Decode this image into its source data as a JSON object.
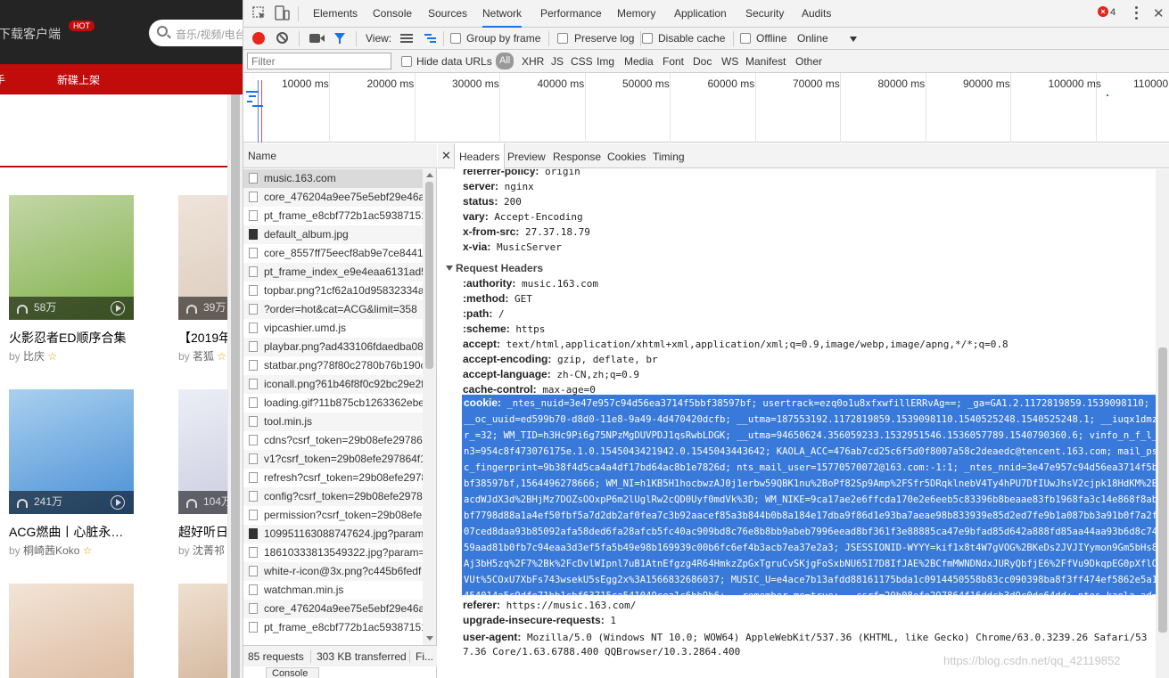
{
  "site": {
    "download_text": "下载客户端",
    "hot_badge": "HOT",
    "search_placeholder": "音乐/视频/电台",
    "subnav_first": "手",
    "subnav_new": "新碟上架",
    "playlists": [
      {
        "count": "58万",
        "title": "火影忍者ED顺序合集",
        "by": "by",
        "author": "比庆",
        "colors": [
          "#7fb24a",
          "#c4d6a8"
        ]
      },
      {
        "count": "39万",
        "title": "【2019年",
        "by": "by",
        "author": "茗狐",
        "colors": [
          "#d8c8b8",
          "#efe4da"
        ]
      },
      {
        "count": "241万",
        "title": "ACG燃曲丨心脏永…",
        "by": "by",
        "author": "桐崎茜Koko",
        "colors": [
          "#4a8fd6",
          "#a9d0ef"
        ]
      },
      {
        "count": "104万",
        "title": "超好听日",
        "by": "by",
        "author": "沈菁祁",
        "colors": [
          "#c6c8dc",
          "#eceef6"
        ]
      },
      {
        "count": "",
        "title": "",
        "by": "",
        "author": "",
        "colors": [
          "#d9b59a",
          "#f3e4d6"
        ]
      },
      {
        "count": "",
        "title": "",
        "by": "",
        "author": "",
        "colors": [
          "#c9a78a",
          "#efe0d0"
        ]
      }
    ]
  },
  "devtools": {
    "tabs": [
      "Elements",
      "Console",
      "Sources",
      "Network",
      "Performance",
      "Memory",
      "Application",
      "Security",
      "Audits"
    ],
    "active_tab": "Network",
    "error_count": "4",
    "toolbar": {
      "view_label": "View:",
      "group_by_frame": "Group by frame",
      "preserve_log": "Preserve log",
      "disable_cache": "Disable cache",
      "offline": "Offline",
      "throttle": "Online"
    },
    "filter_placeholder": "Filter",
    "hide_data_urls": "Hide data URLs",
    "types": [
      "All",
      "XHR",
      "JS",
      "CSS",
      "Img",
      "Media",
      "Font",
      "Doc",
      "WS",
      "Manifest",
      "Other"
    ],
    "timeline_ticks": [
      "10000 ms",
      "20000 ms",
      "30000 ms",
      "40000 ms",
      "50000 ms",
      "60000 ms",
      "70000 ms",
      "80000 ms",
      "90000 ms",
      "100000 ms",
      "110000 ms"
    ],
    "name_header": "Name",
    "requests": [
      {
        "name": "music.163.com",
        "type": "doc"
      },
      {
        "name": "core_476204a9ee75e5ebf29e46af",
        "type": "doc"
      },
      {
        "name": "pt_frame_e8cbf772b1ac59387151",
        "type": "doc"
      },
      {
        "name": "default_album.jpg",
        "type": "img"
      },
      {
        "name": "core_8557ff75eecf8ab9e7ce8441c",
        "type": "doc"
      },
      {
        "name": "pt_frame_index_e9e4eaa6131ad5.",
        "type": "doc"
      },
      {
        "name": "topbar.png?1cf62a10d95832334a",
        "type": "doc"
      },
      {
        "name": "?order=hot&cat=ACG&limit=358",
        "type": "doc"
      },
      {
        "name": "vipcashier.umd.js",
        "type": "doc"
      },
      {
        "name": "playbar.png?ad433106fdaedba08",
        "type": "doc"
      },
      {
        "name": "statbar.png?78f80c2780b76b190c",
        "type": "doc"
      },
      {
        "name": "iconall.png?61b46f8f0c92bc29e2f",
        "type": "doc"
      },
      {
        "name": "loading.gif?11b875cb1263362ebe",
        "type": "doc"
      },
      {
        "name": "tool.min.js",
        "type": "doc"
      },
      {
        "name": "cdns?csrf_token=29b08efe297864",
        "type": "doc"
      },
      {
        "name": "v1?csrf_token=29b08efe297864f1",
        "type": "doc"
      },
      {
        "name": "refresh?csrf_token=29b08efe2978",
        "type": "doc"
      },
      {
        "name": "config?csrf_token=29b08efe2978.",
        "type": "doc"
      },
      {
        "name": "permission?csrf_token=29b08efe2",
        "type": "doc"
      },
      {
        "name": "109951163088747624.jpg?param.",
        "type": "img"
      },
      {
        "name": "18610333813549322.jpg?param=",
        "type": "doc"
      },
      {
        "name": "white-r-icon@3x.png?c445b6fedf",
        "type": "doc"
      },
      {
        "name": "watchman.min.js",
        "type": "doc"
      },
      {
        "name": "core_476204a9ee75e5ebf29e46af",
        "type": "doc"
      },
      {
        "name": "pt_frame_e8cbf772b1ac59387151",
        "type": "doc"
      }
    ],
    "status": {
      "requests": "85 requests",
      "transferred": "303 KB transferred",
      "finish": "Fi..."
    },
    "detail_tabs": [
      "Headers",
      "Preview",
      "Response",
      "Cookies",
      "Timing"
    ],
    "response_headers": [
      {
        "key": "referrer-policy:",
        "value": "origin"
      },
      {
        "key": "server:",
        "value": "nginx"
      },
      {
        "key": "status:",
        "value": "200"
      },
      {
        "key": "vary:",
        "value": "Accept-Encoding"
      },
      {
        "key": "x-from-src:",
        "value": "27.37.18.79"
      },
      {
        "key": "x-via:",
        "value": "MusicServer"
      }
    ],
    "request_headers_title": "Request Headers",
    "request_headers": [
      {
        "key": ":authority:",
        "value": "music.163.com"
      },
      {
        "key": ":method:",
        "value": "GET"
      },
      {
        "key": ":path:",
        "value": "/"
      },
      {
        "key": ":scheme:",
        "value": "https"
      },
      {
        "key": "accept:",
        "value": "text/html,application/xhtml+xml,application/xml;q=0.9,image/webp,image/apng,*/*;q=0.8"
      },
      {
        "key": "accept-encoding:",
        "value": "gzip, deflate, br"
      },
      {
        "key": "accept-language:",
        "value": "zh-CN,zh;q=0.9"
      },
      {
        "key": "cache-control:",
        "value": "max-age=0"
      }
    ],
    "cookie_key": "cookie:",
    "cookie_value": " _ntes_nuid=3e47e957c94d56ea3714f5bbf38597bf; usertrack=ezq0o1u8xfxwfillERRvAg==; _ga=GA1.2.1172819859.1539098110; __oc_uuid=ed599b70-d8d0-11e8-9a49-4d470420dcfb; __utma=187553192.1172819859.1539098110.1540525248.1540525248.1; __iuqx1dmzr_=32; WM_TID=h3Hc9Pi6g75NPzMgDUVPDJ1qsRwbLDGK; __utma=94650624.356059233.1532951546.1536057789.1540790360.6; vinfo_n_f_l_n3=954c8f473076175e.1.0.1545043421942.0.1545043443642; KAOLA_ACC=476ab7cd25c6f5d0f8007a58c2deaedc@tencent.163.com; mail_psc_fingerprint=9b38f4d5ca4a4df17bd64ac8b1e7826d; nts_mail_user=15770570072@163.com:-1:1; _ntes_nnid=3e47e957c94d56ea3714f5bbf38597bf,1564496278666; WM_NI=h1KB5H1hocbwzAJ0j1erbw59QBK1nu%2BoPf82Sp9Amp%2FSfr5DRqklnebV4Ty4hPU7DfIUwJhsV2cjpk18HdKM%2BacdWJdX3d%2BHjMz7DOZsOOxpP6m2lUglRw2cQD0Uyf0mdVk%3D; WM_NIKE=9ca17ae2e6ffcda170e2e6eeb5c83396b8beaae83fb1968fa3c14e868f8abbf7798d88a1a4ef50fbf5a7d2db2af0fea7c3b92aacef85a3b844b0b8a184e17dba9f86d1e93ba7aeae98b833939e85d2ed7fe9b1a087bb3a91b0f7a2f07ced8daa93b85092afa58ded6fa28afcb5fc40ac909bd8c76e8b8bb9abeb7996eead8bf361f3e88885ca47e9bfad85d642a888fd85aa44aa93b6d8c7459aad81b0fb7c94eaa3d3ef5fa5b49e98b169939c00b6fc6ef4b3acb7ea37e2a3; JSESSIONID-WYYY=kif1x8t4W7gVOG%2BKeDs2JVJIYymon9Gm5bHs8Aj3bH5zq%2F7%2Bk%2FcDvlWIpnl7uB1AtnEfgzg4R64HmkzZpGxTgruCvSKjgFoSxbNU65I7D8IfJAE%2BCfmMWNDNdxJURyQbfjE6%2FfVu9DkqpEG0pXflOVUt%5COxU7XbFs743wsekU5sEgg2x%3A1566832686037; MUSIC_U=e4ace7b13afdd88161175bda1c0914450558b83cc090398ba8f3ff474ef5862e5a1454014a5c9dfe71bb1cbf63715ca541049cea1c6bb9b6; __remember_me=true; __csrf=29b08efe297864f16ddcb3d9c0de64dd; ntes_kaola_ad=1",
    "referer_key": "referer:",
    "referer_value": "https://music.163.com/",
    "upgrade_key": "upgrade-insecure-requests:",
    "upgrade_value": "1",
    "ua_key": "user-agent:",
    "ua_value": "Mozilla/5.0 (Windows NT 10.0; WOW64) AppleWebKit/537.36 (KHTML, like Gecko) Chrome/63.0.3239.26 Safari/537.36 Core/1.63.6788.400 QQBrowser/10.3.2864.400",
    "drawer_tab": "Console"
  },
  "watermark": "https://blog.csdn.net/qq_42119852"
}
